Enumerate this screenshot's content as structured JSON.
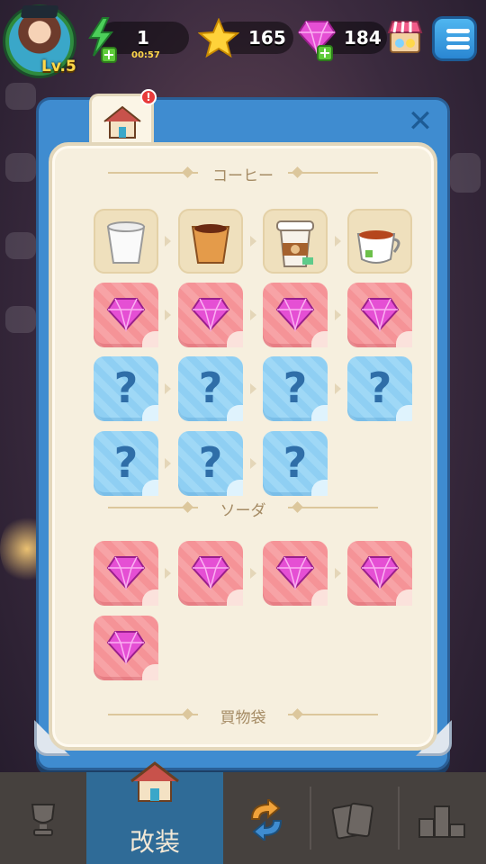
{
  "top_bar": {
    "level": "Lv.5",
    "energy": "1",
    "energy_timer": "00:57",
    "stars": "165",
    "gems": "184"
  },
  "panel": {
    "tab_badge": "!",
    "close_label": "✕",
    "sections": [
      {
        "title": "コーヒー"
      },
      {
        "title": "ソーダ"
      },
      {
        "title": "買物袋"
      }
    ],
    "unknown_label": "?"
  },
  "bottom_nav": {
    "items": [
      {
        "name": "trophy",
        "label": ""
      },
      {
        "name": "renovate",
        "label": "改装"
      },
      {
        "name": "exchange",
        "label": ""
      },
      {
        "name": "cards",
        "label": ""
      },
      {
        "name": "ranking",
        "label": ""
      }
    ]
  },
  "colors": {
    "panel_blue": "#3f8cd0",
    "gem_pink": "#e54fd4",
    "nav_active": "#2f6b97"
  }
}
